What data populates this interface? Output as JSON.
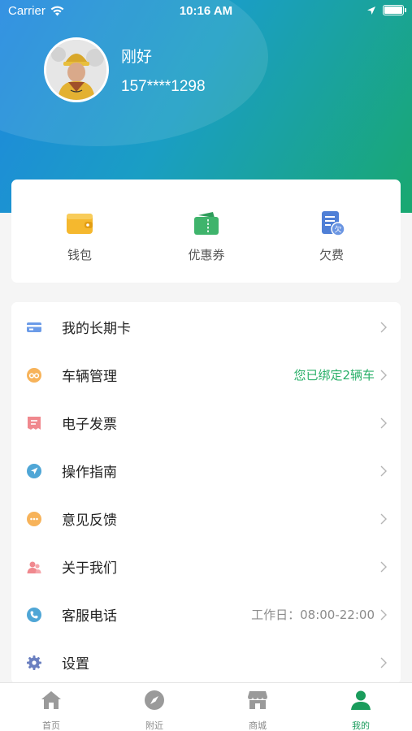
{
  "status_bar": {
    "carrier": "Carrier",
    "time": "10:16 AM"
  },
  "profile": {
    "name": "刚好",
    "phone": "157****1298"
  },
  "quick_actions": [
    {
      "label": "钱包",
      "icon": "wallet-icon"
    },
    {
      "label": "优惠券",
      "icon": "coupon-icon"
    },
    {
      "label": "欠费",
      "icon": "arrears-icon",
      "badge": "欠"
    }
  ],
  "menu": [
    {
      "label": "我的长期卡",
      "value": "",
      "icon": "card-icon",
      "color": "#6b9be8"
    },
    {
      "label": "车辆管理",
      "value": "您已绑定2辆车",
      "icon": "vehicle-icon",
      "color": "#f7b35a"
    },
    {
      "label": "电子发票",
      "value": "",
      "icon": "invoice-icon",
      "color": "#f0888e"
    },
    {
      "label": "操作指南",
      "value": "",
      "icon": "guide-icon",
      "color": "#4fa6d6"
    },
    {
      "label": "意见反馈",
      "value": "",
      "icon": "feedback-icon",
      "color": "#f7b35a"
    },
    {
      "label": "关于我们",
      "value": "",
      "icon": "about-icon",
      "color": "#f0888e"
    },
    {
      "label": "客服电话",
      "value": "工作日：08:00-22:00",
      "icon": "phone-icon",
      "color": "#4fa6d6"
    },
    {
      "label": "设置",
      "value": "",
      "icon": "settings-icon",
      "color": "#6a7fc0"
    }
  ],
  "tabs": [
    {
      "label": "首页",
      "icon": "home-icon",
      "active": false
    },
    {
      "label": "附近",
      "icon": "compass-icon",
      "active": false
    },
    {
      "label": "商城",
      "icon": "store-icon",
      "active": false
    },
    {
      "label": "我的",
      "icon": "user-icon",
      "active": true
    }
  ],
  "colors": {
    "accent": "#1a9c5c",
    "value_green": "#2bb06a",
    "value_gray": "#8c8c8c"
  }
}
